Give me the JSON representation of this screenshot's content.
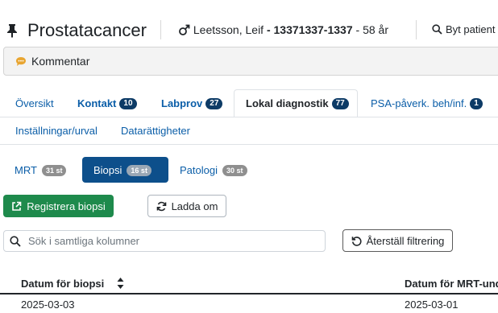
{
  "header": {
    "title": "Prostatacancer",
    "patient_name": "Leetsson, Leif",
    "patient_dash1": "-",
    "patient_id": "13371337-1337",
    "patient_dash2": "-",
    "patient_age": "58 år",
    "change_patient_label": "Byt patient"
  },
  "comment": {
    "label": "Kommentar"
  },
  "tabs": [
    {
      "label": "Översikt",
      "badge": ""
    },
    {
      "label": "Kontakt",
      "badge": "10"
    },
    {
      "label": "Labprov",
      "badge": "27"
    },
    {
      "label": "Lokal diagnostik",
      "badge": "77"
    },
    {
      "label": "PSA-påverk. beh/inf.",
      "badge": "1"
    },
    {
      "label": "Inställningar/urval",
      "badge": ""
    },
    {
      "label": "Datarättigheter",
      "badge": ""
    }
  ],
  "active_tab": "Lokal diagnostik",
  "subtabs": [
    {
      "label": "MRT",
      "badge": "31 st"
    },
    {
      "label": "Biopsi",
      "badge": "16 st"
    },
    {
      "label": "Patologi",
      "badge": "30 st"
    }
  ],
  "active_subtab": "Biopsi",
  "actions": {
    "register_label": "Registrera biopsi",
    "reload_label": "Ladda om",
    "reset_filter_label": "Återställ filtrering"
  },
  "search": {
    "placeholder": "Sök i samtliga kolumner",
    "value": ""
  },
  "table": {
    "columns": [
      "Datum för biopsi",
      "Datum för MRT-und"
    ],
    "rows": [
      [
        "2025-03-03",
        "2025-03-01"
      ]
    ]
  },
  "colors": {
    "link": "#0b5ea8",
    "active_pill": "#0d4f8b",
    "badge_dark": "#0d3b66",
    "badge_gray": "#8f8f8f",
    "green_button": "#1e8a4c"
  },
  "icons": {
    "pin": "pin-icon",
    "gender": "male-icon",
    "search": "search-icon",
    "comment": "comment-icon",
    "external": "external-link-icon",
    "reload": "refresh-icon",
    "reset": "undo-icon",
    "sort": "sort-icon"
  }
}
